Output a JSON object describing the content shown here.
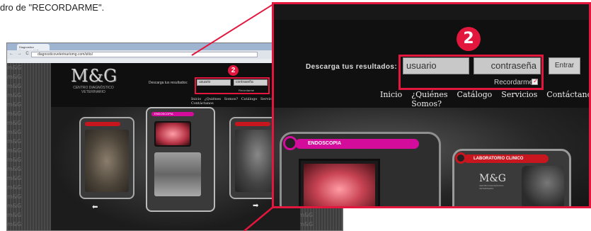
{
  "caption": "dro de  \"RECORDARME\".",
  "annotation": {
    "number": "2",
    "color": "#e3173e"
  },
  "browser": {
    "tab_title": "Diagnostico Veterinario M.G.",
    "url": "diagnosticoveterinariomg.com/sitio/",
    "nav_icons": "← → C ⌂"
  },
  "site": {
    "logo": "M&G",
    "logo_subtitle": "CENTRO DIAGNÓSTICO VETERINARIO",
    "login": {
      "label": "Descarga tus resultados:",
      "username_placeholder": "usuario",
      "password_placeholder": "contraseña",
      "remember_label": "Recordarme",
      "submit_label": "Entrar",
      "remember_checked": true
    },
    "nav": [
      "Inicio",
      "¿Quiénes Somos?",
      "Catálogo",
      "Servicios",
      "Contáctanos"
    ],
    "cards": [
      {
        "label": "ENDOSCOPIA",
        "color": "#d30c9b"
      },
      {
        "label": "LABORATORIO CLINICO",
        "color": "#c8161e"
      }
    ],
    "watermark": "m&G"
  }
}
